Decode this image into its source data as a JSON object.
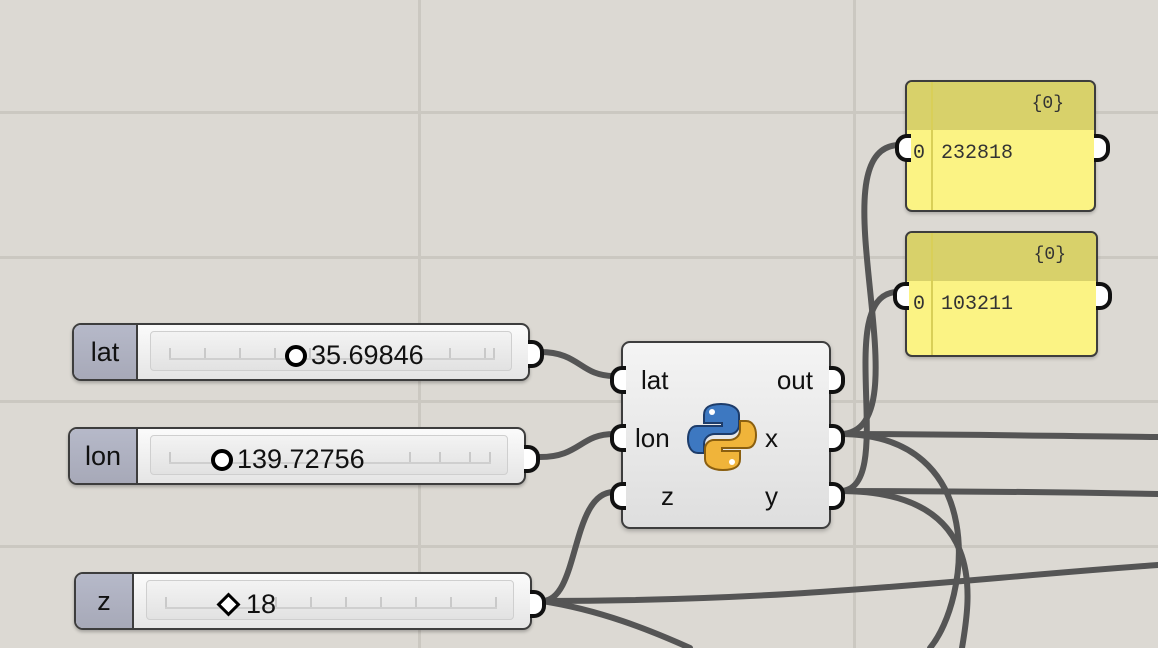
{
  "sliders": [
    {
      "name": "lat",
      "value": "35.69846"
    },
    {
      "name": "lon",
      "value": "139.72756"
    },
    {
      "name": "z",
      "value": "18"
    }
  ],
  "component": {
    "type_icon": "python-icon",
    "inputs": [
      "lat",
      "lon",
      "z"
    ],
    "outputs": [
      "out",
      "x",
      "y"
    ]
  },
  "panels": [
    {
      "path": "{0}",
      "index": "0",
      "value": "232818"
    },
    {
      "path": "{0}",
      "index": "0",
      "value": "103211"
    }
  ],
  "colors": {
    "canvas": "#dcd9d3",
    "panel": "#fbf384",
    "panel_header": "#d8d16a",
    "slider_name": "#aeb0bf",
    "wire": "#555555"
  }
}
